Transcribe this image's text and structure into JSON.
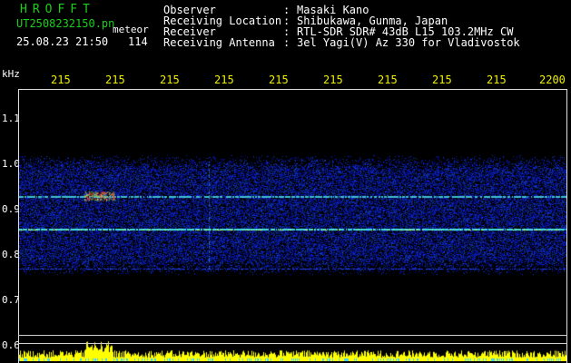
{
  "header": {
    "app_title": "HROFFT",
    "filename": "UT2508232150.pn",
    "meteor_label": "meteor",
    "datetime": "25.08.23 21:50",
    "count": "114"
  },
  "info": [
    {
      "label": "Observer",
      "sep": ":",
      "value": "Masaki Kano"
    },
    {
      "label": "Receiving Location",
      "sep": ":",
      "value": "Shibukawa, Gunma, Japan"
    },
    {
      "label": "Receiver",
      "sep": ":",
      "value": "RTL-SDR SDR# 43dB L15 103.2MHz CW"
    },
    {
      "label": "Receiving Antenna",
      "sep": ":",
      "value": "3el Yagi(V) Az 330 for Vladivostok"
    }
  ],
  "axes": {
    "y_unit": "kHz",
    "x_ticks": [
      "215",
      "215",
      "215",
      "215",
      "215",
      "215",
      "215",
      "215",
      "215",
      "2200"
    ],
    "y_ticks": [
      "1.1",
      "1.0",
      "0.9",
      "0.8",
      "0.7",
      "0.6"
    ]
  },
  "colors": {
    "label_green": "#18d018",
    "text_white": "#ffffff",
    "tick_yellow": "#f0f000",
    "background": "#000000",
    "waterfall_blue": "#1030c0",
    "signal_cyan": "#40e0e0",
    "meteor_red": "#ff3030",
    "bottom_bar_yellow": "#ffff00"
  }
}
